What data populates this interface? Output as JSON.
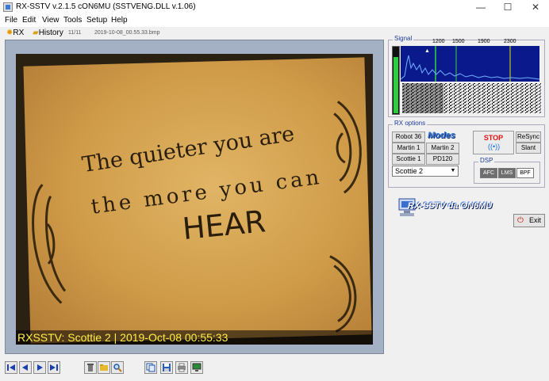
{
  "window": {
    "title": "RX-SSTV v.2.1.5 cON6MU (SSTVENG.DLL v.1.06)",
    "minimize": "—",
    "maximize": "☐",
    "close": "✕"
  },
  "menu": [
    "File",
    "Edit",
    "View",
    "Tools",
    "Setup",
    "Help"
  ],
  "toolbar": {
    "rx_label": "RX",
    "history_label": "History",
    "counter": "11/11",
    "filename": "2019-10-08_00.55.33.bmp"
  },
  "image": {
    "handwriting_line1": "The quieter you are",
    "handwriting_line2": "the more you can",
    "handwriting_line3": "HEAR",
    "caption": "RXSSTV: Scottie 2 | 2019-Oct-08 00:55:33"
  },
  "signal": {
    "label": "Signal",
    "freq_labels": [
      "1200",
      "1500",
      "1900",
      "2300"
    ],
    "level": 0.85,
    "colors": {
      "spectrum_bg": "#0a1a8c",
      "trace": "#6fb0ff",
      "marker_green": "#35d43a",
      "marker_yellow": "#e6e600"
    }
  },
  "rx_options": {
    "label": "RX options",
    "modes_label": "Modes",
    "mode_buttons": [
      "Robot 36",
      "Martin 1",
      "Martin 2",
      "Scottie 1",
      "PD120"
    ],
    "selected_mode": "Scottie 2",
    "stop_label": "STOP",
    "resync_label": "ReSync",
    "slant_label": "Slant"
  },
  "dsp": {
    "label": "DSP",
    "buttons": [
      "AFC",
      "LMS",
      "BPF"
    ]
  },
  "brand_text": "RX-SSTV da ON6MU",
  "exit_label": "Exit",
  "icons": {
    "nav": [
      "first-icon",
      "prev-icon",
      "next-icon",
      "last-icon"
    ],
    "file": [
      "delete-icon",
      "open-folder-icon",
      "search-icon"
    ],
    "action": [
      "copy-icon",
      "save-icon",
      "print-icon",
      "monitor-icon"
    ]
  }
}
